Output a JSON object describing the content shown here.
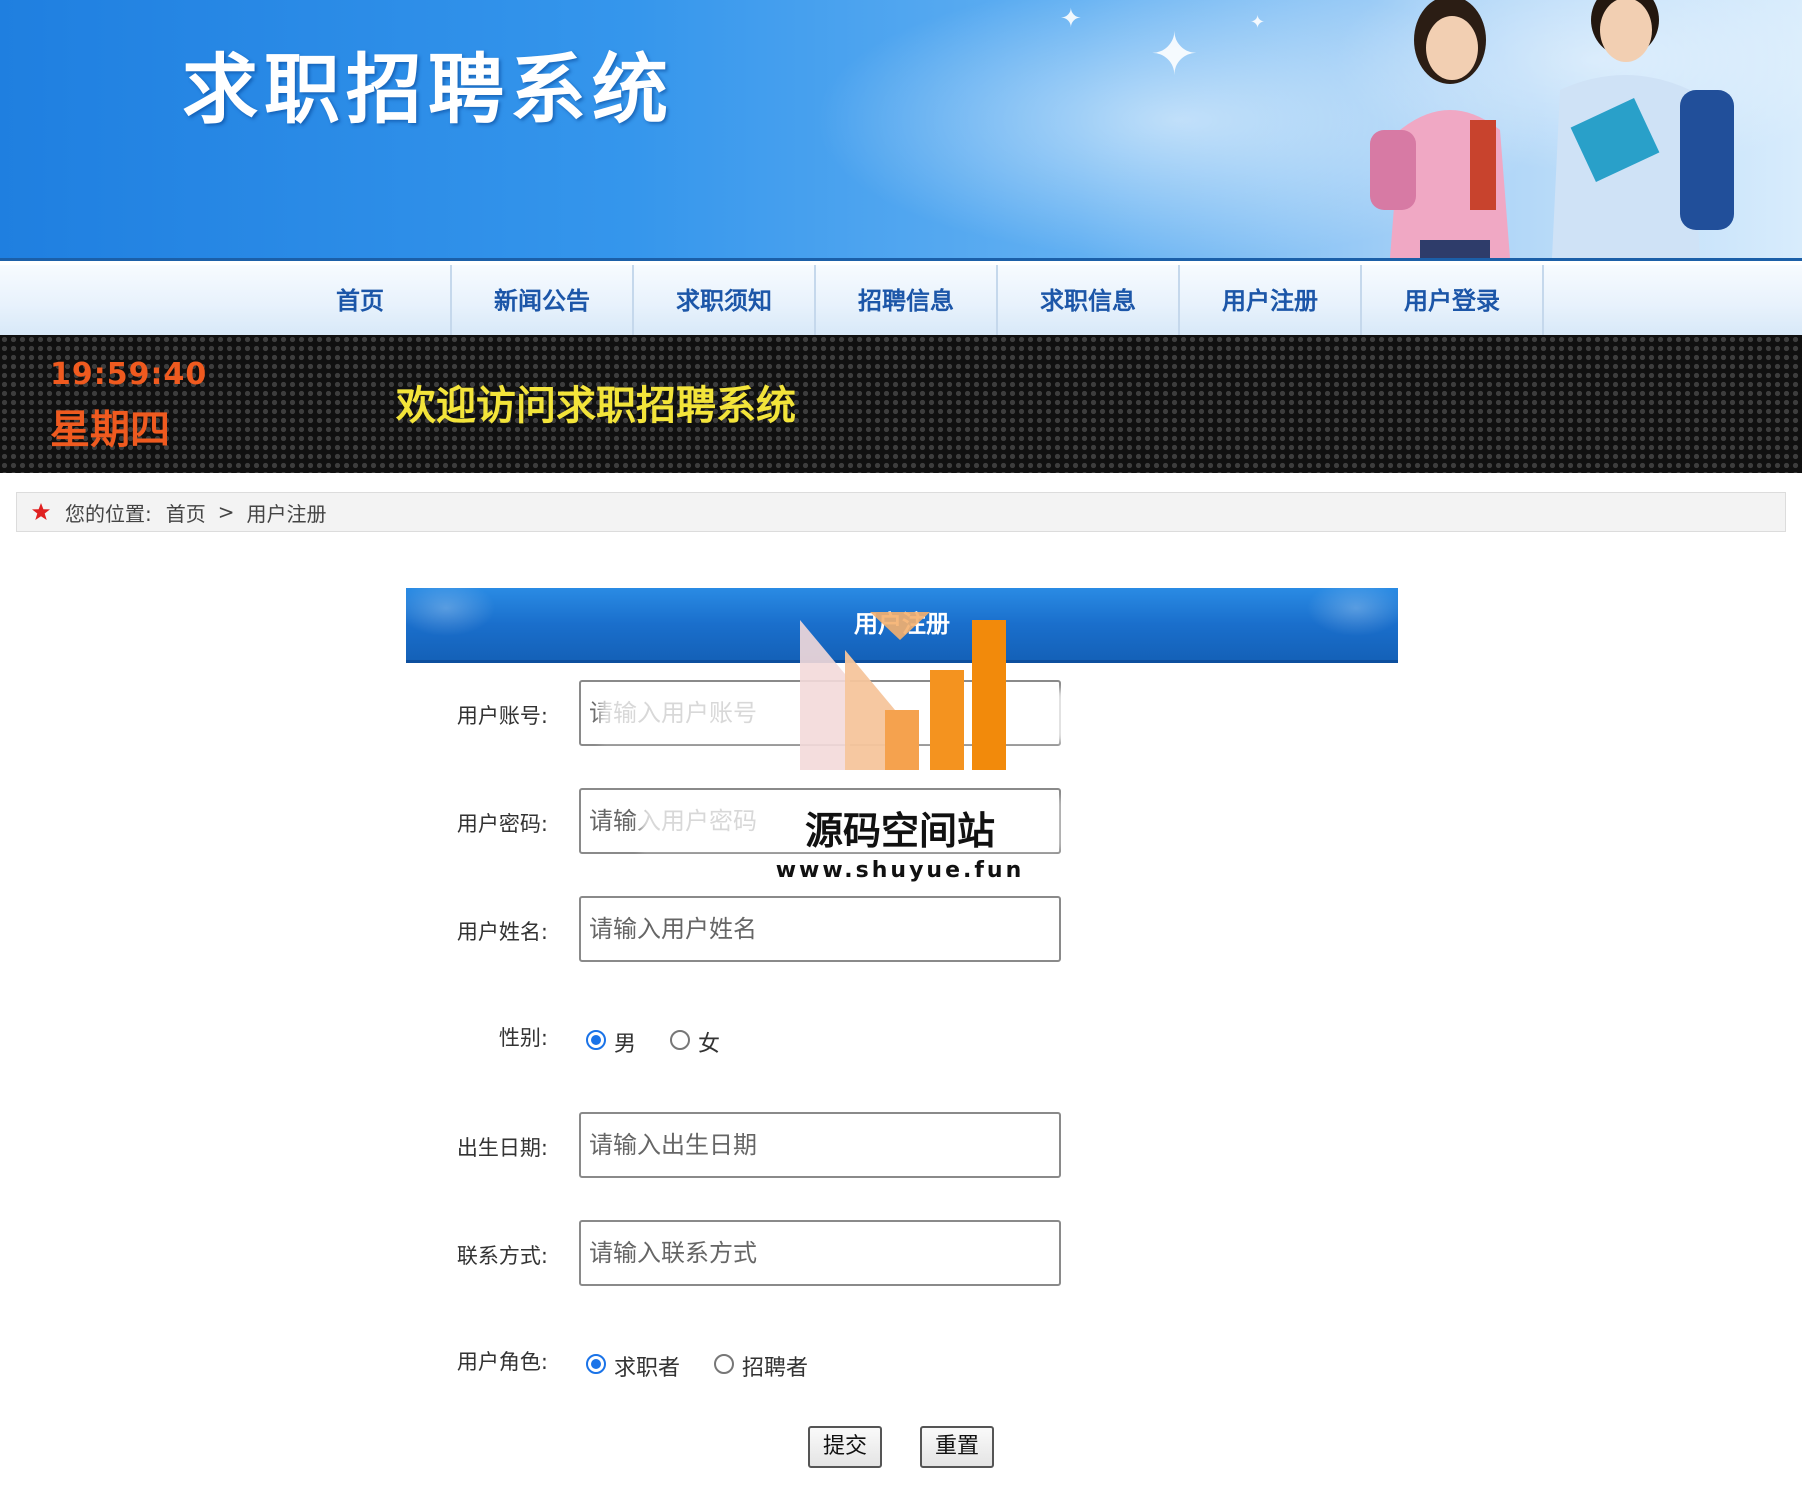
{
  "banner": {
    "title": "求职招聘系统"
  },
  "nav": {
    "items": [
      {
        "label": "首页"
      },
      {
        "label": "新闻公告"
      },
      {
        "label": "求职须知"
      },
      {
        "label": "招聘信息"
      },
      {
        "label": "求职信息"
      },
      {
        "label": "用户注册"
      },
      {
        "label": "用户登录"
      }
    ]
  },
  "led": {
    "time": "19:59:40",
    "day": "星期四",
    "welcome": "欢迎访问求职招聘系统"
  },
  "breadcrumb": {
    "prefix": "您的位置:",
    "home": "首页",
    "separator": ">",
    "current": "用户注册"
  },
  "form": {
    "title": "用户注册",
    "account": {
      "label": "用户账号:",
      "placeholder": "请输入用户账号"
    },
    "password": {
      "label": "用户密码:",
      "placeholder": "请输入用户密码"
    },
    "name": {
      "label": "用户姓名:",
      "placeholder": "请输入用户姓名"
    },
    "gender": {
      "label": "性别:",
      "options": [
        "男",
        "女"
      ],
      "selected": "男"
    },
    "birthdate": {
      "label": "出生日期:",
      "placeholder": "请输入出生日期"
    },
    "contact": {
      "label": "联系方式:",
      "placeholder": "请输入联系方式"
    },
    "role": {
      "label": "用户角色:",
      "options": [
        "求职者",
        "招聘者"
      ],
      "selected": "求职者"
    },
    "submit_label": "提交",
    "reset_label": "重置"
  },
  "watermark": {
    "brand": "源码空间站",
    "url": "www.shuyue.fun"
  },
  "colors": {
    "nav_text": "#1c56a8",
    "led_time": "#ef5a1f",
    "led_welcome": "#f3e43a",
    "form_header": "#1a6fcc",
    "radio_checked": "#1a73e8"
  }
}
